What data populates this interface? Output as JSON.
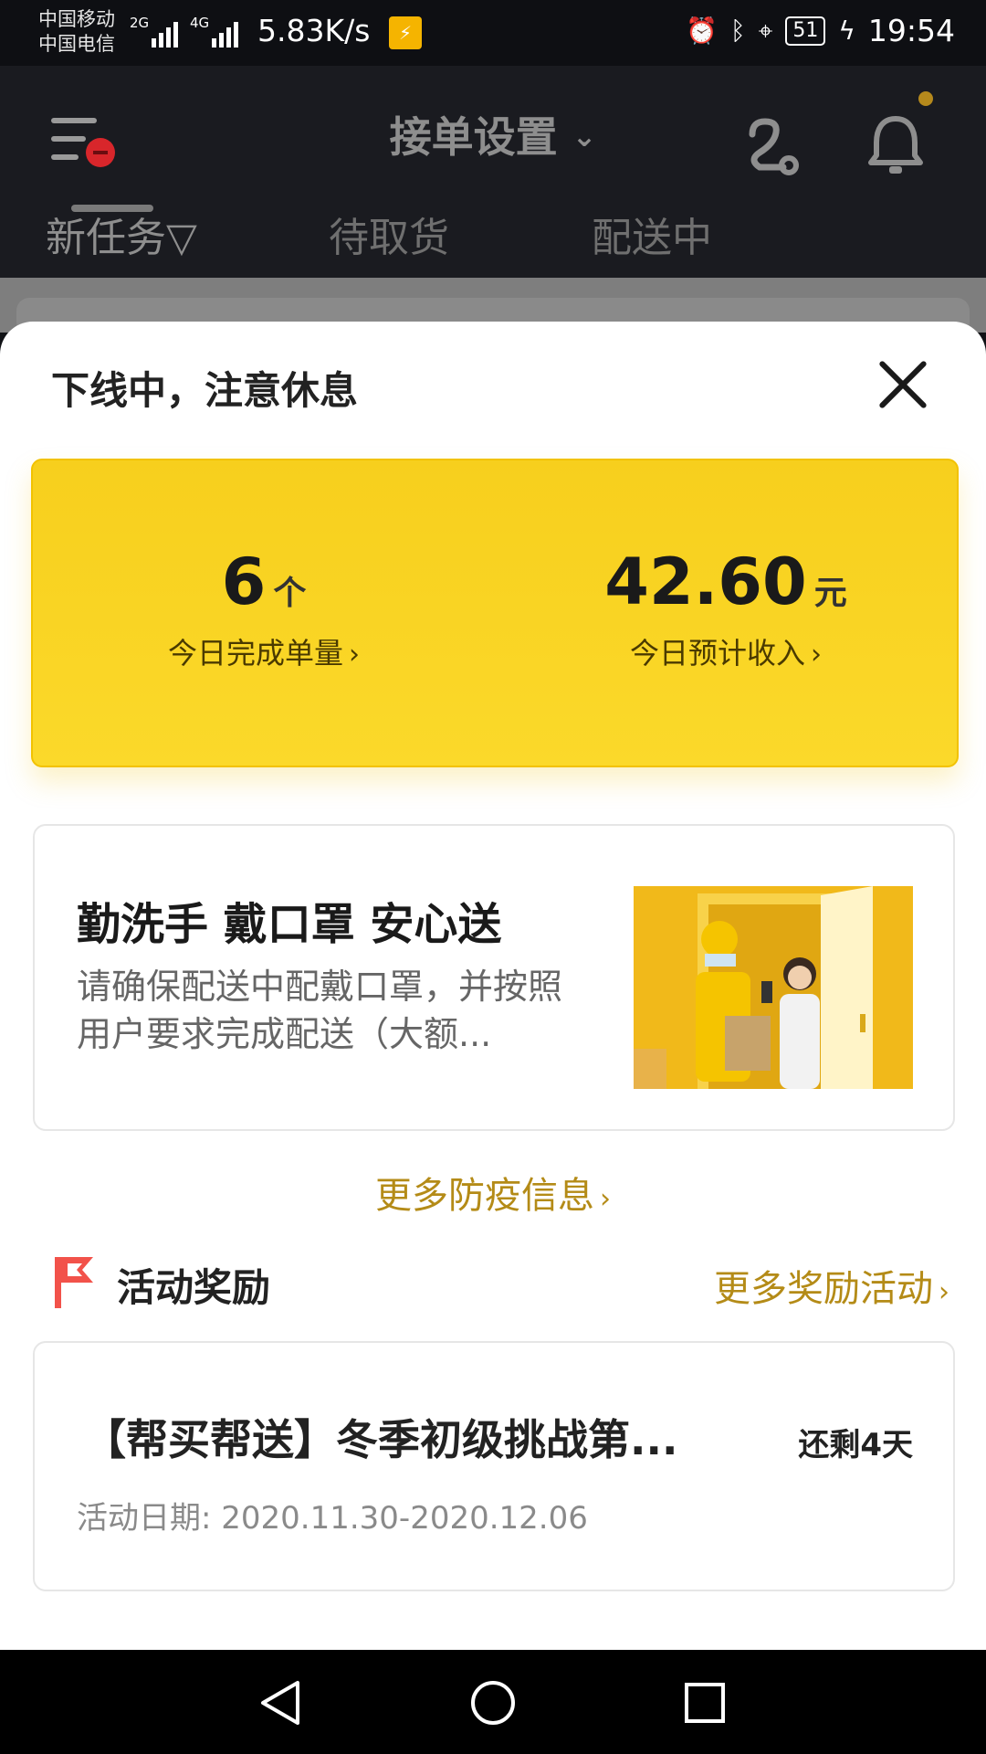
{
  "status_bar": {
    "carrier_1": "中国移动",
    "carrier_2": "中国电信",
    "sig_1": "2G",
    "sig_2": "4G",
    "net_speed": "5.83K/s",
    "battery": "51",
    "time": "19:54"
  },
  "header": {
    "title": "接单设置",
    "tabs": [
      "新任务▽",
      "待取货",
      "配送中"
    ]
  },
  "sheet": {
    "title": "下线中，注意休息",
    "stats": {
      "orders_value": "6",
      "orders_unit": "个",
      "orders_label": "今日完成单量",
      "income_value": "42.60",
      "income_unit": "元",
      "income_label": "今日预计收入"
    },
    "tip": {
      "title": "勤洗手 戴口罩 安心送",
      "body": "请确保配送中配戴口罩，并按照用户要求完成配送（大额..."
    },
    "more_info": "更多防疫信息",
    "rewards": {
      "section_title": "活动奖励",
      "more": "更多奖励活动",
      "activity_title": "【帮买帮送】冬季初级挑战第...",
      "days_left": "还剩4天",
      "date": "活动日期: 2020.11.30-2020.12.06"
    }
  },
  "colors": {
    "accent_yellow": "#f7cf1d",
    "gold_text": "#b48b17",
    "flag_red": "#f2524a"
  }
}
